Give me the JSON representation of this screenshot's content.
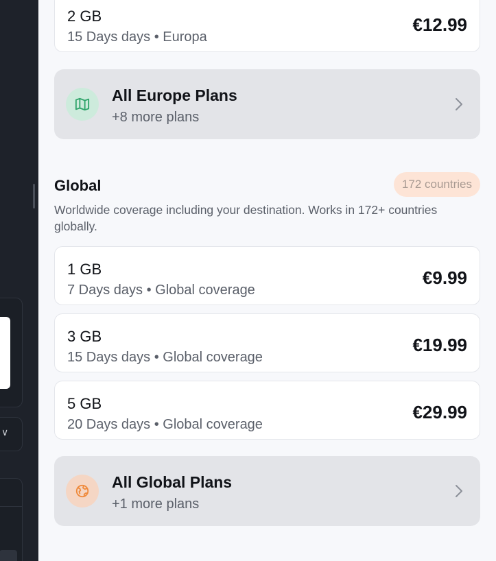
{
  "backdrop": {
    "dropdown_glyph": "∨"
  },
  "europe_top_plan": {
    "size": "2 GB",
    "meta": "15 Days days • Europa",
    "price": "€12.99"
  },
  "europe_more": {
    "icon": "map-icon",
    "title": "All Europe Plans",
    "subtitle": "+8 more plans",
    "icon_bg": "#cdebdc",
    "icon_color": "#2fa46a"
  },
  "global": {
    "title": "Global",
    "badge": "172 countries",
    "description": "Worldwide coverage including your destination. Works in 172+ countries globally.",
    "plans": [
      {
        "size": "1 GB",
        "meta": "7 Days days • Global coverage",
        "price": "€9.99"
      },
      {
        "size": "3 GB",
        "meta": "15 Days days • Global coverage",
        "price": "€19.99"
      },
      {
        "size": "5 GB",
        "meta": "20 Days days • Global coverage",
        "price": "€29.99"
      }
    ],
    "more": {
      "icon": "globe-icon",
      "title": "All Global Plans",
      "subtitle": "+1 more plans",
      "icon_bg": "#f5d6c4",
      "icon_color": "#ef8a3c"
    }
  }
}
